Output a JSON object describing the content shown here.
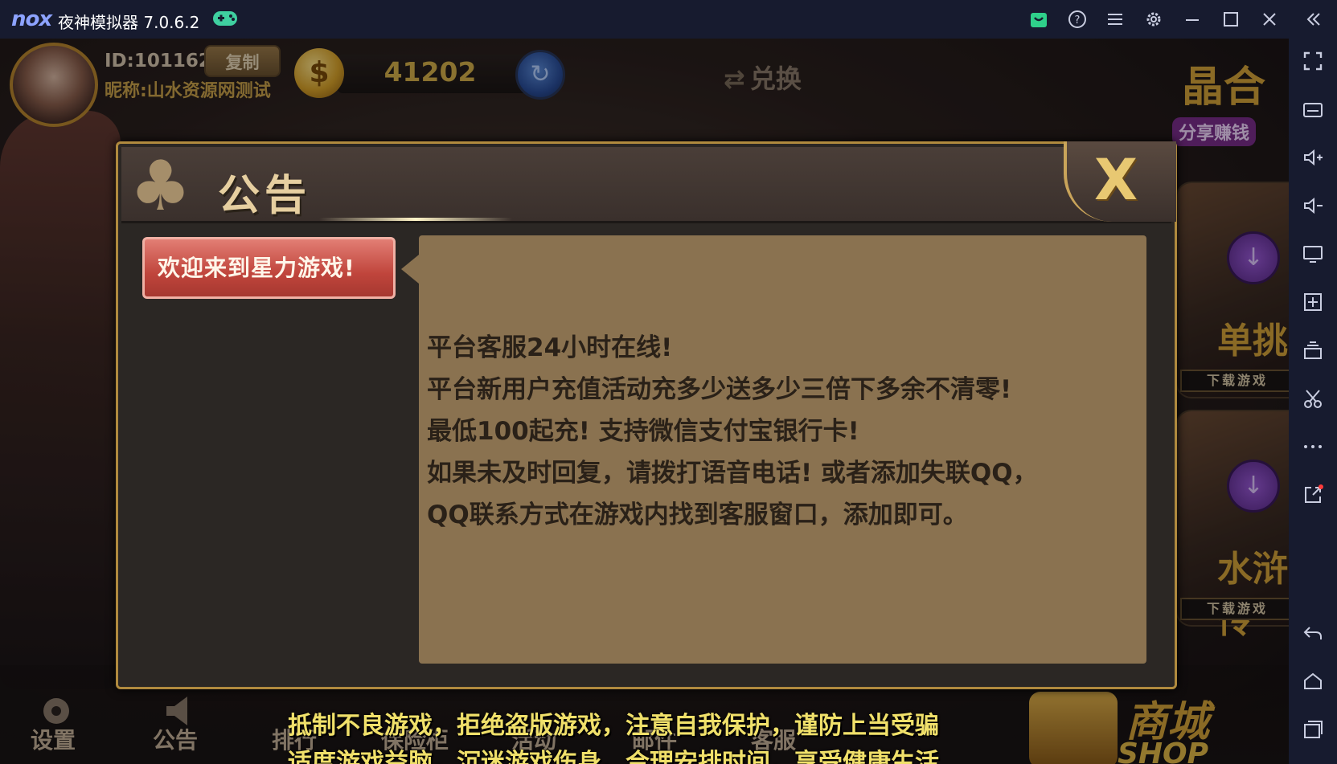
{
  "emulator": {
    "logo": "nox",
    "title": "夜神模拟器 7.0.6.2",
    "icons": [
      "gamepad-icon",
      "store-icon",
      "help-icon",
      "menu-icon",
      "settings-icon",
      "minimize-icon",
      "maximize-icon",
      "close-icon",
      "collapse-sidebar-icon"
    ],
    "sidebar_icons": [
      "fullscreen-icon",
      "keyboard-icon",
      "volume-up-icon",
      "volume-down-icon",
      "screen-icon",
      "add-apk-icon",
      "multi-instance-icon",
      "screenshot-icon",
      "more-icon",
      "open-external-icon",
      "back-icon",
      "home-icon",
      "recent-apps-icon"
    ]
  },
  "user": {
    "id": "ID:101162",
    "copy_label": "复制",
    "nickname": "昵称:山水资源网测试",
    "coins": "41202"
  },
  "header": {
    "exchange_label": "兑换",
    "share_big": "晶合",
    "share_label": "分享赚钱"
  },
  "side_games": [
    {
      "name": "单挑",
      "download_label": "下载游戏"
    },
    {
      "name": "水浒传",
      "download_label": "下载游戏"
    }
  ],
  "dialog": {
    "title": "公告",
    "close_label": "X",
    "tab_label": "欢迎来到星力游戏!",
    "lines": [
      "平台客服24小时在线!",
      "平台新用户充值活动充多少送多少三倍下多余不清零!",
      "最低100起充!  支持微信支付宝银行卡!",
      "如果未及时回复，请拨打语音电话!  或者添加失联QQ，",
      "QQ联系方式在游戏内找到客服窗口，添加即可。"
    ]
  },
  "bottom_nav": [
    {
      "label": "设置",
      "icon": "gear-icon"
    },
    {
      "label": "公告",
      "icon": "speaker-icon"
    },
    {
      "label": "排行",
      "icon": "ranking-icon"
    },
    {
      "label": "保险柜",
      "icon": "safe-icon"
    },
    {
      "label": "活动",
      "icon": "activity-icon"
    },
    {
      "label": "邮件",
      "icon": "mail-icon"
    },
    {
      "label": "客服",
      "icon": "customer-service-icon"
    }
  ],
  "marquee": {
    "line1": "抵制不良游戏，拒绝盗版游戏，注意自我保护，谨防上当受骗",
    "line2": "适度游戏益脑，沉迷游戏伤身，合理安排时间，享受健康生活"
  },
  "shop": {
    "label_cn": "商城",
    "label_en": "SHOP"
  },
  "colors": {
    "titlebar_bg": "#171b2f",
    "dialog_border": "#b08a3e",
    "tab_red": "#c0453c",
    "panel_bg": "#8a7250",
    "marquee_text": "#f0e06a",
    "gold": "#d4a43a"
  }
}
